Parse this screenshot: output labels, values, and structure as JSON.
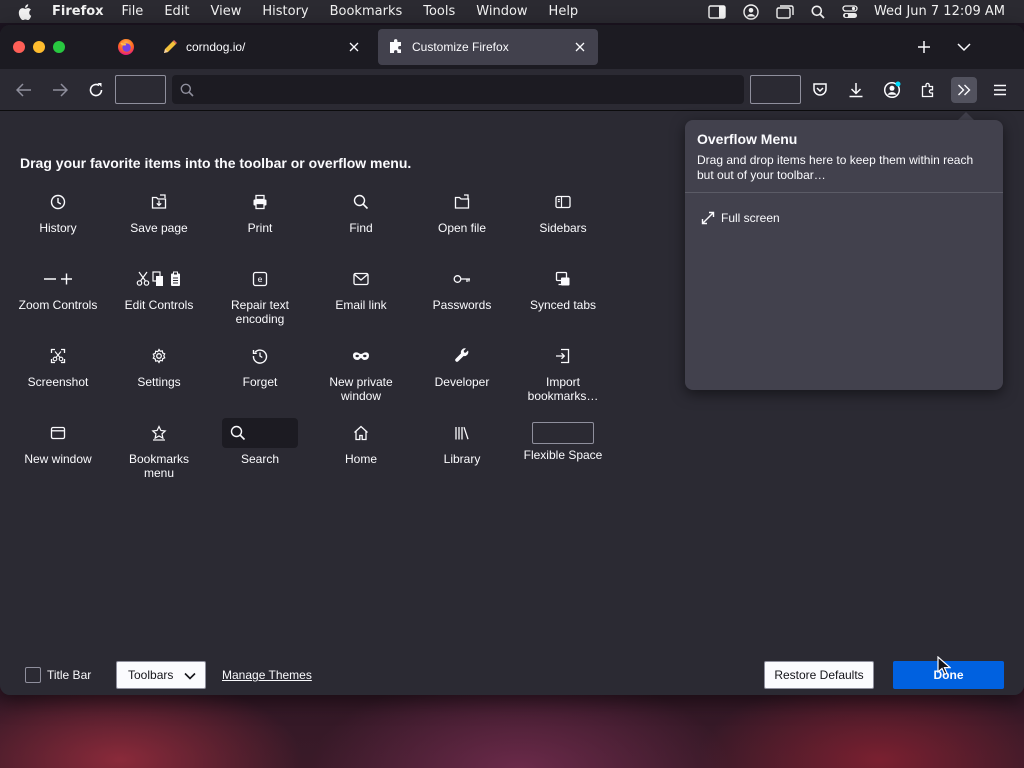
{
  "menubar": {
    "app_name": "Firefox",
    "items": [
      "File",
      "Edit",
      "View",
      "History",
      "Bookmarks",
      "Tools",
      "Window",
      "Help"
    ],
    "clock": "Wed Jun 7  12:09 AM"
  },
  "tabs": [
    {
      "title": "corndog.io/",
      "icon": "pencil-icon",
      "active": false
    },
    {
      "title": "Customize Firefox",
      "icon": "puzzle-icon",
      "active": true
    }
  ],
  "urlbar": {
    "value": "",
    "placeholder": ""
  },
  "customize": {
    "instructions": "Drag your favorite items into the toolbar or overflow menu.",
    "palette": [
      {
        "label": "History",
        "icon": "clock-icon"
      },
      {
        "label": "Save page",
        "icon": "save-page-icon"
      },
      {
        "label": "Print",
        "icon": "printer-icon"
      },
      {
        "label": "Find",
        "icon": "search-icon"
      },
      {
        "label": "Open file",
        "icon": "folder-icon"
      },
      {
        "label": "Sidebars",
        "icon": "sidebar-icon"
      },
      {
        "label": "Zoom Controls",
        "icon": "zoom-controls-icon"
      },
      {
        "label": "Edit Controls",
        "icon": "edit-controls-icon"
      },
      {
        "label": "Repair text encoding",
        "icon": "text-encoding-icon"
      },
      {
        "label": "Email link",
        "icon": "envelope-icon"
      },
      {
        "label": "Passwords",
        "icon": "key-icon"
      },
      {
        "label": "Synced tabs",
        "icon": "synced-tabs-icon"
      },
      {
        "label": "Screenshot",
        "icon": "screenshot-icon"
      },
      {
        "label": "Settings",
        "icon": "gear-icon"
      },
      {
        "label": "Forget",
        "icon": "forget-icon"
      },
      {
        "label": "New private window",
        "icon": "private-mask-icon"
      },
      {
        "label": "Developer",
        "icon": "wrench-icon"
      },
      {
        "label": "Import bookmarks…",
        "icon": "import-icon"
      },
      {
        "label": "New window",
        "icon": "window-icon"
      },
      {
        "label": "Bookmarks menu",
        "icon": "bookmark-star-icon"
      },
      {
        "label": "Search",
        "icon": "search-icon"
      },
      {
        "label": "Home",
        "icon": "home-icon"
      },
      {
        "label": "Library",
        "icon": "library-icon"
      },
      {
        "label": "Flexible Space",
        "icon": "flexible-space-icon"
      }
    ]
  },
  "overflow_panel": {
    "title": "Overflow Menu",
    "description": "Drag and drop items here to keep them within reach but out of your toolbar…",
    "items": [
      {
        "label": "Full screen",
        "icon": "fullscreen-icon"
      }
    ]
  },
  "footer": {
    "title_bar_label": "Title Bar",
    "title_bar_checked": false,
    "toolbars_label": "Toolbars",
    "manage_themes": "Manage Themes",
    "restore_defaults": "Restore Defaults",
    "done": "Done"
  },
  "colors": {
    "accent": "#0061e0",
    "toolbar_bg": "#2b2a33",
    "tabstrip_bg": "#1c1b22",
    "panel_bg": "#42414d"
  }
}
